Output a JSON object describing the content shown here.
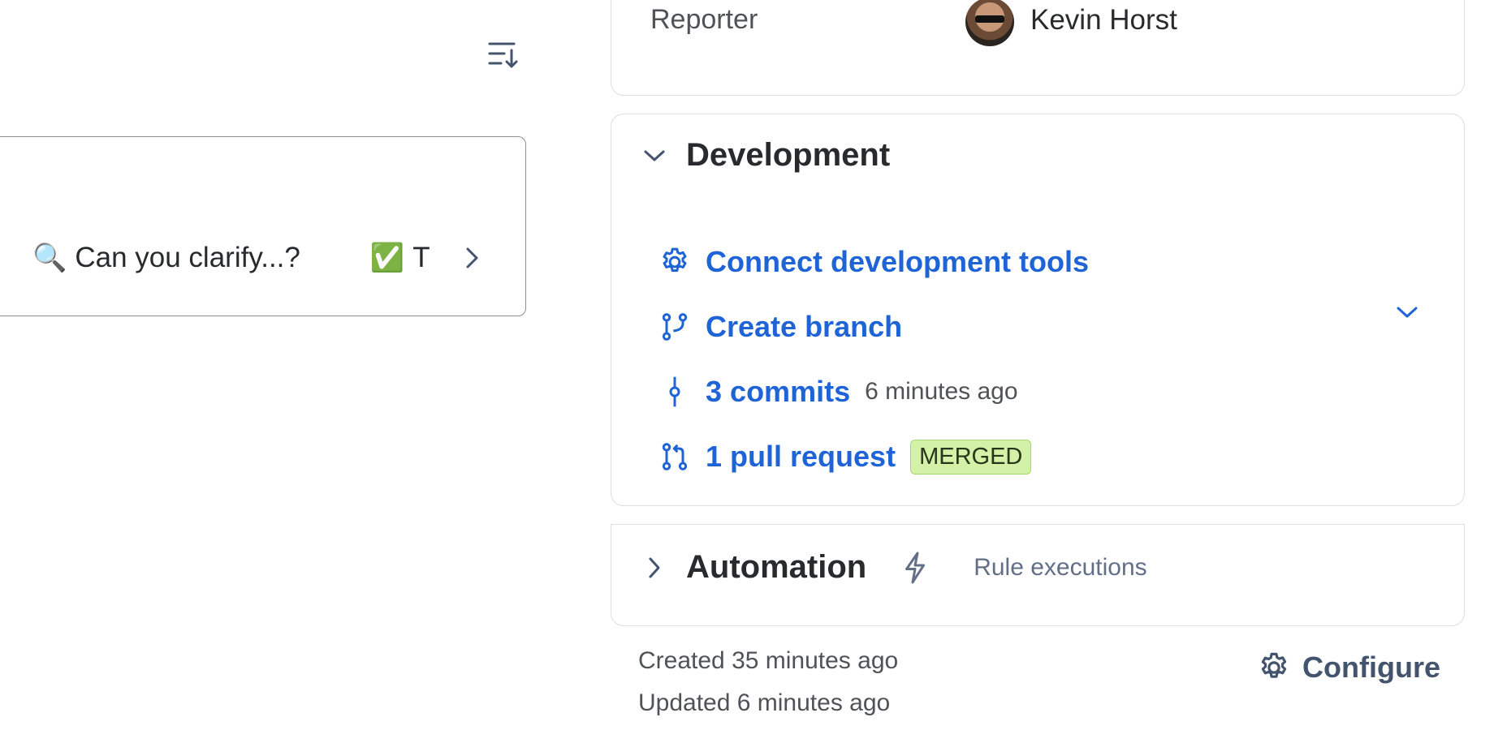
{
  "reporter": {
    "label": "Reporter",
    "name": "Kevin Horst"
  },
  "quick_actions": {
    "clarify_emoji": "🔍",
    "clarify_label": "Can you clarify...?",
    "next_emoji": "✅",
    "next_label": "T"
  },
  "development": {
    "title": "Development",
    "connect_label": "Connect development tools",
    "branch_label": "Create branch",
    "commits_count": "3",
    "commits_label": "commits",
    "commits_time": "6 minutes ago",
    "pr_label": "1 pull request",
    "pr_status": "MERGED"
  },
  "automation": {
    "title": "Automation",
    "rule_executions": "Rule executions"
  },
  "footer": {
    "created": "Created 35 minutes ago",
    "updated": "Updated 6 minutes ago",
    "configure_label": "Configure"
  },
  "colors": {
    "link": "#1f64d6",
    "merged_bg": "#d3f1a7",
    "border": "#dcdfe4"
  }
}
